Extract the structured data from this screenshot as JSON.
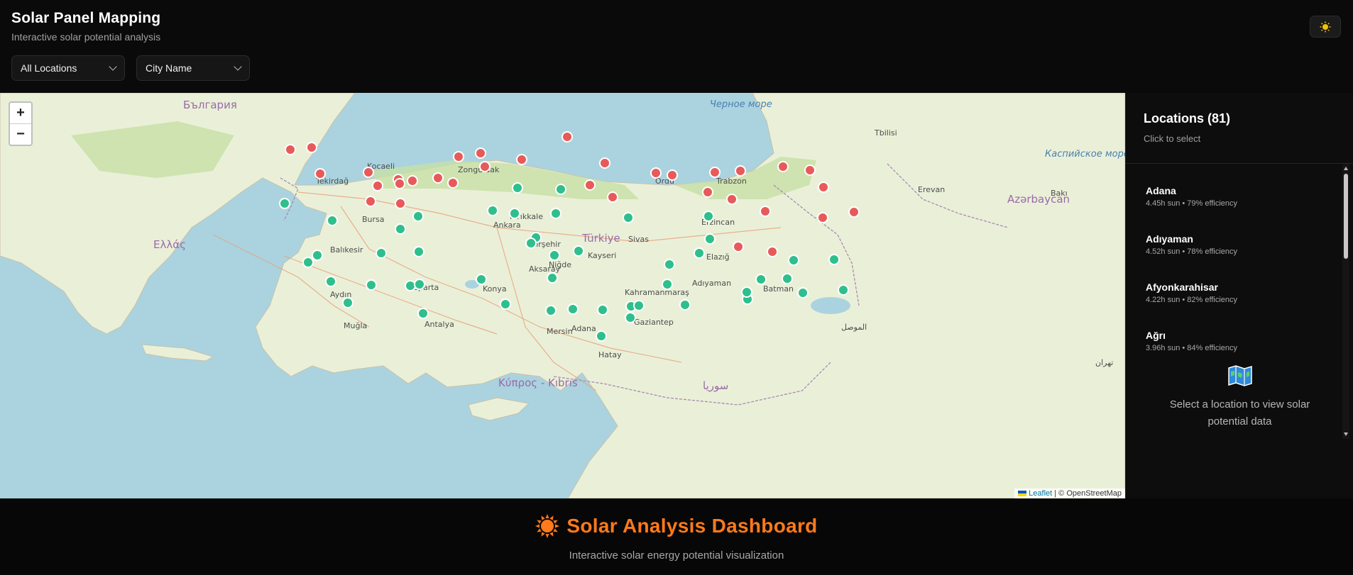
{
  "header": {
    "title": "Solar Panel Mapping",
    "subtitle": "Interactive solar potential analysis",
    "theme_icon": "sun-icon"
  },
  "filters": {
    "location_filter": "All Locations",
    "sort_by": "City Name"
  },
  "map": {
    "zoom_in": "+",
    "zoom_out": "−",
    "attribution_leaflet": "Leaflet",
    "attribution_osm": "| © OpenStreetMap",
    "marker_colors": {
      "high": "#2fbf8c",
      "low": "#e85a5a"
    },
    "labels": [
      {
        "text": "Черное море",
        "kind": "sea"
      },
      {
        "text": "Türkiye",
        "kind": "country"
      },
      {
        "text": "Ankara",
        "kind": "city"
      },
      {
        "text": "Bursa",
        "kind": "city"
      },
      {
        "text": "Balıkesir",
        "kind": "city"
      },
      {
        "text": "Aydın",
        "kind": "city"
      },
      {
        "text": "Antalya",
        "kind": "city"
      },
      {
        "text": "Konya",
        "kind": "city"
      },
      {
        "text": "Aksaray",
        "kind": "city"
      },
      {
        "text": "Kayseri",
        "kind": "city"
      },
      {
        "text": "Sivas",
        "kind": "city"
      },
      {
        "text": "Adana",
        "kind": "city"
      },
      {
        "text": "Mersin",
        "kind": "city"
      },
      {
        "text": "Gaziantep",
        "kind": "city"
      },
      {
        "text": "Adıyaman",
        "kind": "city"
      },
      {
        "text": "Batman",
        "kind": "city"
      },
      {
        "text": "Elazığ",
        "kind": "city"
      },
      {
        "text": "Erzincan",
        "kind": "city"
      },
      {
        "text": "Trabzon",
        "kind": "city"
      },
      {
        "text": "Ordu",
        "kind": "city"
      },
      {
        "text": "Tekirdağ",
        "kind": "city"
      },
      {
        "text": "Kocaeli",
        "kind": "city"
      },
      {
        "text": "Zonguldak",
        "kind": "city"
      },
      {
        "text": "Kırşehir",
        "kind": "city"
      },
      {
        "text": "Kırıkkale",
        "kind": "city"
      },
      {
        "text": "Niğde",
        "kind": "city"
      },
      {
        "text": "Isparta",
        "kind": "city"
      },
      {
        "text": "Kahramanmaraş",
        "kind": "city"
      },
      {
        "text": "Hatay",
        "kind": "city"
      },
      {
        "text": "Muğla",
        "kind": "city"
      },
      {
        "text": "Κύπρος - Kıbrıs",
        "kind": "country"
      },
      {
        "text": "Ελλάς",
        "kind": "country"
      },
      {
        "text": "България",
        "kind": "country"
      },
      {
        "text": "Azərbaycan",
        "kind": "country"
      },
      {
        "text": "Каспийское море",
        "kind": "sea"
      },
      {
        "text": "Tbilisi",
        "kind": "city"
      },
      {
        "text": "Bakı",
        "kind": "city"
      },
      {
        "text": "Erevan",
        "kind": "city"
      },
      {
        "text": "تهران",
        "kind": "city"
      },
      {
        "text": "الموصل",
        "kind": "city"
      },
      {
        "text": "سوريا",
        "kind": "country"
      }
    ]
  },
  "panel": {
    "title": "Locations (81)",
    "subtitle": "Click to select",
    "items": [
      {
        "name": "Adana",
        "meta": "4.45h sun • 79% efficiency"
      },
      {
        "name": "Adıyaman",
        "meta": "4.52h sun • 78% efficiency"
      },
      {
        "name": "Afyonkarahisar",
        "meta": "4.22h sun • 82% efficiency"
      },
      {
        "name": "Ağrı",
        "meta": "3.96h sun • 84% efficiency"
      }
    ],
    "empty_text": "Select a location to view solar potential data"
  },
  "footer": {
    "title": "Solar Analysis Dashboard",
    "subtitle": "Interactive solar energy potential visualization"
  }
}
